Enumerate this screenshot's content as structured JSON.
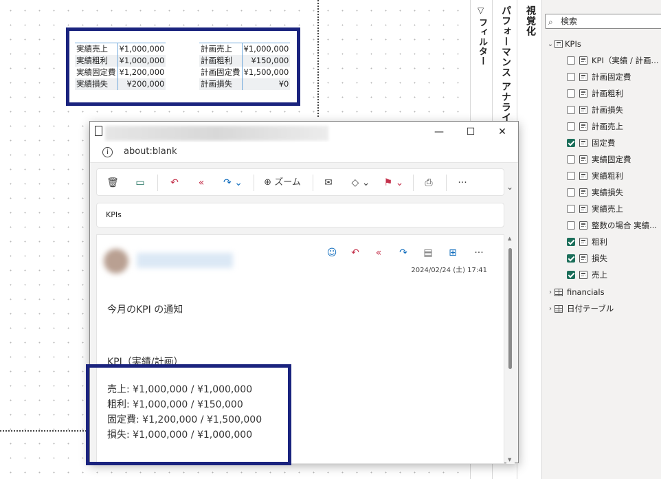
{
  "kpi_table": {
    "left": [
      {
        "label": "実績売上",
        "value": "¥1,000,000"
      },
      {
        "label": "実績粗利",
        "value": "¥1,000,000"
      },
      {
        "label": "実績固定費",
        "value": "¥1,200,000"
      },
      {
        "label": "実績損失",
        "value": "¥200,000"
      }
    ],
    "right": [
      {
        "label": "計画売上",
        "value": "¥1,000,000"
      },
      {
        "label": "計画粗利",
        "value": "¥150,000"
      },
      {
        "label": "計画固定費",
        "value": "¥1,500,000"
      },
      {
        "label": "計画損失",
        "value": "¥0"
      }
    ]
  },
  "panels": {
    "filter_label": "フィルター",
    "filter_icon": "▽",
    "performance_label": "パフォーマンス アナライザ",
    "visualization_label": "視覚化"
  },
  "data_pane": {
    "search_placeholder": "検索",
    "kpis_table": "KPIs",
    "fields": [
      {
        "label": "KPI（実績 / 計画...",
        "checked": false
      },
      {
        "label": "計画固定費",
        "checked": false
      },
      {
        "label": "計画粗利",
        "checked": false
      },
      {
        "label": "計画損失",
        "checked": false
      },
      {
        "label": "計画売上",
        "checked": false
      },
      {
        "label": "固定費",
        "checked": true
      },
      {
        "label": "実績固定費",
        "checked": false
      },
      {
        "label": "実績粗利",
        "checked": false
      },
      {
        "label": "実績損失",
        "checked": false
      },
      {
        "label": "実績売上",
        "checked": false
      },
      {
        "label": "整数の場合 実績...",
        "checked": false
      },
      {
        "label": "粗利",
        "checked": true
      },
      {
        "label": "損失",
        "checked": true
      },
      {
        "label": "売上",
        "checked": true
      }
    ],
    "other_tables": [
      "financials",
      "日付テーブル"
    ]
  },
  "mail": {
    "address": "about:blank",
    "toolbar": {
      "zoom_label": "ズーム",
      "more": "···"
    },
    "subject": "KPIs",
    "date": "2024/02/24 (土) 17:41",
    "body_lines": [
      "今月のKPI の通知",
      "KPI（実績/計画）",
      "売上: ¥1,000,000 / ¥1,000,000",
      "粗利: ¥1,000,000 / ¥150,000",
      "固定費: ¥1,200,000 / ¥1,500,000",
      "損失: ¥1,000,000 / ¥1,000,000"
    ]
  },
  "colors": {
    "highlight": "#1a237e",
    "check": "#1b6e5a",
    "table_border": "#6fa8dc"
  }
}
